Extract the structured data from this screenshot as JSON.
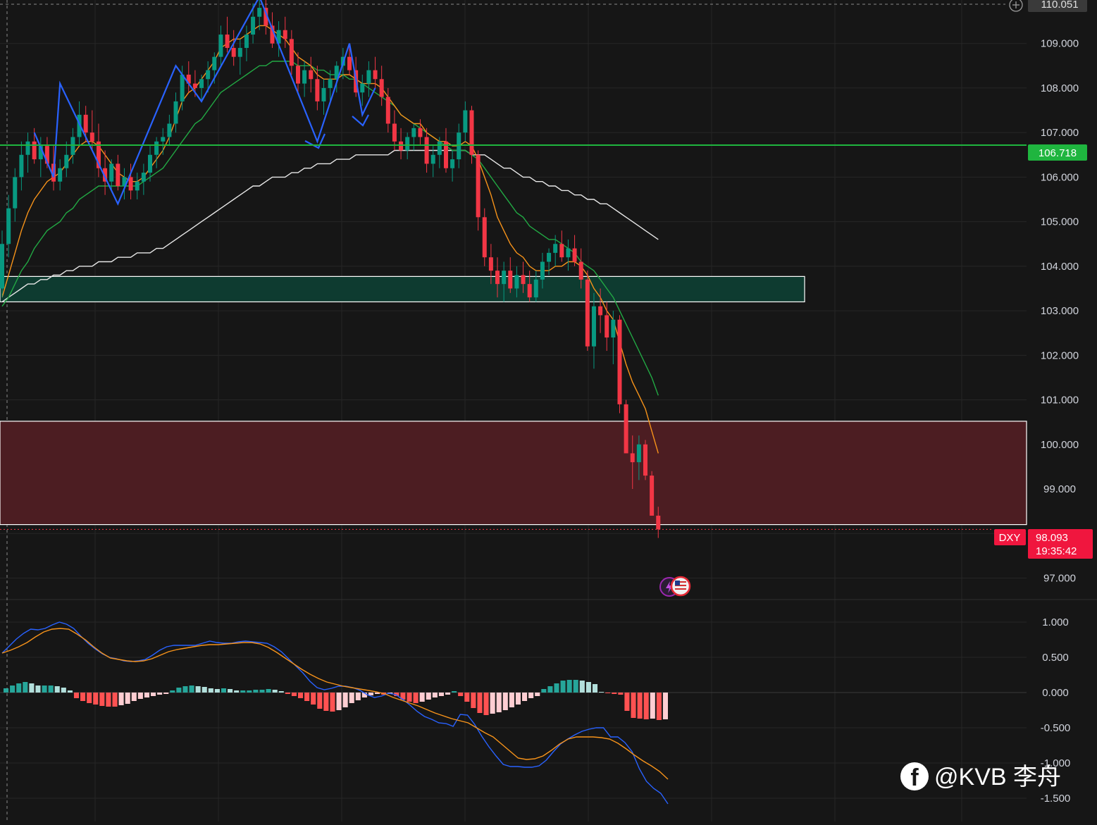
{
  "symbol": "DXY",
  "price_axis": {
    "ticks": [
      "110.051",
      "109.000",
      "108.000",
      "107.000",
      "106.000",
      "105.000",
      "104.000",
      "103.000",
      "102.000",
      "101.000",
      "100.000",
      "99.000",
      "97.000"
    ],
    "tick_values": [
      110.051,
      109,
      108,
      107,
      106,
      105,
      104,
      103,
      102,
      101,
      100,
      99,
      97
    ],
    "range": [
      96.5,
      110.1
    ]
  },
  "macd_axis": {
    "ticks": [
      "1.000",
      "0.500",
      "0.000",
      "-0.500",
      "-1.000",
      "-1.500"
    ],
    "tick_values": [
      1,
      0.5,
      0,
      -0.5,
      -1,
      -1.5
    ],
    "range": [
      -1.8,
      1.5
    ]
  },
  "labels": {
    "last_price": "98.093",
    "countdown": "19:35:42",
    "support_price": "106.718",
    "symbol_tag": "DXY",
    "watermark": "@KVB 李舟"
  },
  "colors": {
    "background": "#161616",
    "bull": "#089981",
    "bear": "#f23645",
    "ma_fast": "#f7931a",
    "ma_mid": "#22a944",
    "ma_slow": "#e8e8e8",
    "support_line": "#1fb53f",
    "zigzag": "#2962ff",
    "demand_zone": "#0e3b30",
    "supply_zone": "#4c1d22",
    "macd_line": "#2962ff",
    "signal_line": "#f7931a"
  },
  "chart_data": {
    "type": "candlestick",
    "symbol": "DXY",
    "last_price": 98.093,
    "horizontal_line": 106.718,
    "zones": [
      {
        "kind": "demand",
        "from": 103.2,
        "to": 103.77,
        "x_end": 140
      },
      {
        "kind": "supply",
        "from": 98.2,
        "to": 100.52
      }
    ],
    "ylim": [
      96.5,
      110.1
    ],
    "candles": [
      [
        103.5,
        104.8,
        103.3,
        104.5
      ],
      [
        104.5,
        105.6,
        104.2,
        105.3
      ],
      [
        105.3,
        106.2,
        105.0,
        106.0
      ],
      [
        106.0,
        106.8,
        105.7,
        106.5
      ],
      [
        106.5,
        107.0,
        106.1,
        106.8
      ],
      [
        106.8,
        107.1,
        106.3,
        106.4
      ],
      [
        106.4,
        106.9,
        106.0,
        106.7
      ],
      [
        106.7,
        106.9,
        106.2,
        106.3
      ],
      [
        106.3,
        106.7,
        105.7,
        105.9
      ],
      [
        105.9,
        106.4,
        105.7,
        106.2
      ],
      [
        106.2,
        106.8,
        106.0,
        106.5
      ],
      [
        106.5,
        107.1,
        106.3,
        106.9
      ],
      [
        106.9,
        107.7,
        106.7,
        107.4
      ],
      [
        107.4,
        107.6,
        106.8,
        107.0
      ],
      [
        107.0,
        107.5,
        106.6,
        106.8
      ],
      [
        106.8,
        107.2,
        106.0,
        106.2
      ],
      [
        106.2,
        106.6,
        105.6,
        105.9
      ],
      [
        105.9,
        106.4,
        105.7,
        106.3
      ],
      [
        106.3,
        106.5,
        105.7,
        105.8
      ],
      [
        105.8,
        106.2,
        105.5,
        106.0
      ],
      [
        106.0,
        106.3,
        105.5,
        105.7
      ],
      [
        105.7,
        106.1,
        105.5,
        105.9
      ],
      [
        105.9,
        106.3,
        105.6,
        106.1
      ],
      [
        106.1,
        106.7,
        105.9,
        106.5
      ],
      [
        106.5,
        106.9,
        106.2,
        106.8
      ],
      [
        106.8,
        107.1,
        106.5,
        106.9
      ],
      [
        106.9,
        107.4,
        106.7,
        107.2
      ],
      [
        107.2,
        107.9,
        107.0,
        107.7
      ],
      [
        107.7,
        108.5,
        107.5,
        108.3
      ],
      [
        108.3,
        108.6,
        107.9,
        108.1
      ],
      [
        108.1,
        108.4,
        107.8,
        108.0
      ],
      [
        108.0,
        108.3,
        107.7,
        108.2
      ],
      [
        108.2,
        108.6,
        107.9,
        108.4
      ],
      [
        108.4,
        108.8,
        108.1,
        108.7
      ],
      [
        108.7,
        109.4,
        108.5,
        109.2
      ],
      [
        109.2,
        109.6,
        108.8,
        108.9
      ],
      [
        108.9,
        109.3,
        108.5,
        108.7
      ],
      [
        108.7,
        109.1,
        108.3,
        108.9
      ],
      [
        108.9,
        109.4,
        108.6,
        109.2
      ],
      [
        109.2,
        109.9,
        109.0,
        109.6
      ],
      [
        109.6,
        110.05,
        109.3,
        109.8
      ],
      [
        109.8,
        110.0,
        109.2,
        109.4
      ],
      [
        109.4,
        109.7,
        108.9,
        109.0
      ],
      [
        109.0,
        109.5,
        108.7,
        109.3
      ],
      [
        109.3,
        109.6,
        108.9,
        109.1
      ],
      [
        109.1,
        109.3,
        108.3,
        108.5
      ],
      [
        108.5,
        108.8,
        107.9,
        108.1
      ],
      [
        108.1,
        108.6,
        107.8,
        108.4
      ],
      [
        108.4,
        108.7,
        107.9,
        108.2
      ],
      [
        108.2,
        108.5,
        107.5,
        107.7
      ],
      [
        107.7,
        108.2,
        107.4,
        108.0
      ],
      [
        108.0,
        108.4,
        107.7,
        108.2
      ],
      [
        108.2,
        108.6,
        107.9,
        108.5
      ],
      [
        108.5,
        108.9,
        108.2,
        108.7
      ],
      [
        108.7,
        109.0,
        108.3,
        108.4
      ],
      [
        108.4,
        108.7,
        107.8,
        107.9
      ],
      [
        107.9,
        108.3,
        107.6,
        108.1
      ],
      [
        108.1,
        108.6,
        107.8,
        108.4
      ],
      [
        108.4,
        108.7,
        108.0,
        108.2
      ],
      [
        108.2,
        108.5,
        107.6,
        107.8
      ],
      [
        107.8,
        108.0,
        107.0,
        107.2
      ],
      [
        107.2,
        107.5,
        106.6,
        106.8
      ],
      [
        106.8,
        107.1,
        106.4,
        106.6
      ],
      [
        106.6,
        107.0,
        106.4,
        106.9
      ],
      [
        106.9,
        107.2,
        106.6,
        107.1
      ],
      [
        107.1,
        107.3,
        106.7,
        106.9
      ],
      [
        106.9,
        107.1,
        106.1,
        106.3
      ],
      [
        106.3,
        106.7,
        106.0,
        106.5
      ],
      [
        106.5,
        106.9,
        106.2,
        106.8
      ],
      [
        106.8,
        107.1,
        106.1,
        106.2
      ],
      [
        106.2,
        106.6,
        105.9,
        106.4
      ],
      [
        106.4,
        107.2,
        106.2,
        107.0
      ],
      [
        107.0,
        107.7,
        106.8,
        107.5
      ],
      [
        107.5,
        107.6,
        106.3,
        106.5
      ],
      [
        106.5,
        106.6,
        104.8,
        105.1
      ],
      [
        105.1,
        105.3,
        104.0,
        104.2
      ],
      [
        104.2,
        104.5,
        103.6,
        103.9
      ],
      [
        103.9,
        104.2,
        103.3,
        103.6
      ],
      [
        103.6,
        104.1,
        103.2,
        103.9
      ],
      [
        103.9,
        104.2,
        103.4,
        103.5
      ],
      [
        103.5,
        104.0,
        103.3,
        103.8
      ],
      [
        103.8,
        104.1,
        103.4,
        103.6
      ],
      [
        103.6,
        103.9,
        103.2,
        103.3
      ],
      [
        103.3,
        103.9,
        103.2,
        103.7
      ],
      [
        103.7,
        104.3,
        103.5,
        104.1
      ],
      [
        104.1,
        104.4,
        103.8,
        104.3
      ],
      [
        104.3,
        104.7,
        104.0,
        104.5
      ],
      [
        104.5,
        104.8,
        104.1,
        104.2
      ],
      [
        104.2,
        104.6,
        103.9,
        104.4
      ],
      [
        104.4,
        104.7,
        104.0,
        104.1
      ],
      [
        104.1,
        104.4,
        103.5,
        103.7
      ],
      [
        103.7,
        103.9,
        102.1,
        102.2
      ],
      [
        102.2,
        103.4,
        101.7,
        103.1
      ],
      [
        103.1,
        103.5,
        102.5,
        102.9
      ],
      [
        102.9,
        103.2,
        102.1,
        102.4
      ],
      [
        102.4,
        103.0,
        101.8,
        102.8
      ],
      [
        102.8,
        102.9,
        100.7,
        100.9
      ],
      [
        100.9,
        101.0,
        99.9,
        99.8
      ],
      [
        99.8,
        100.2,
        99.0,
        99.6
      ],
      [
        99.6,
        100.2,
        99.2,
        100.0
      ],
      [
        100.0,
        100.1,
        99.2,
        99.3
      ],
      [
        99.3,
        99.4,
        98.4,
        98.4
      ],
      [
        98.4,
        98.6,
        97.9,
        98.093
      ]
    ],
    "ma_fast": [
      103.3,
      103.8,
      104.3,
      104.8,
      105.2,
      105.5,
      105.7,
      105.9,
      106.0,
      106.1,
      106.3,
      106.5,
      106.7,
      106.8,
      106.8,
      106.7,
      106.5,
      106.3,
      106.1,
      106.0,
      105.9,
      105.9,
      106.0,
      106.2,
      106.4,
      106.6,
      106.9,
      107.3,
      107.7,
      107.9,
      108.0,
      108.2,
      108.4,
      108.6,
      108.9,
      109.0,
      109.1,
      109.1,
      109.2,
      109.3,
      109.4,
      109.4,
      109.3,
      109.2,
      109.1,
      108.9,
      108.7,
      108.6,
      108.5,
      108.3,
      108.2,
      108.2,
      108.2,
      108.3,
      108.3,
      108.2,
      108.1,
      108.1,
      108.1,
      108.0,
      107.8,
      107.6,
      107.4,
      107.3,
      107.2,
      107.2,
      107.0,
      106.9,
      106.8,
      106.8,
      106.7,
      106.7,
      106.8,
      106.7,
      106.4,
      106.0,
      105.6,
      105.1,
      104.8,
      104.5,
      104.3,
      104.2,
      104.0,
      103.9,
      103.9,
      103.9,
      104.0,
      104.0,
      104.1,
      104.1,
      104.0,
      103.8,
      103.5,
      103.3,
      103.0,
      102.8,
      102.3,
      101.8,
      101.4,
      101.1,
      100.8,
      100.3,
      99.8
    ],
    "ma_mid": [
      103.1,
      103.3,
      103.6,
      103.9,
      104.1,
      104.4,
      104.6,
      104.8,
      104.9,
      105.0,
      105.2,
      105.3,
      105.5,
      105.6,
      105.7,
      105.8,
      105.8,
      105.8,
      105.8,
      105.8,
      105.8,
      105.8,
      105.9,
      106.0,
      106.1,
      106.2,
      106.4,
      106.6,
      106.8,
      107.0,
      107.2,
      107.3,
      107.5,
      107.7,
      107.9,
      108.0,
      108.1,
      108.2,
      108.3,
      108.4,
      108.5,
      108.5,
      108.6,
      108.6,
      108.6,
      108.6,
      108.5,
      108.5,
      108.5,
      108.4,
      108.4,
      108.3,
      108.3,
      108.3,
      108.2,
      108.2,
      108.1,
      108.0,
      107.9,
      107.8,
      107.7,
      107.6,
      107.4,
      107.3,
      107.2,
      107.1,
      107.0,
      106.9,
      106.8,
      106.7,
      106.6,
      106.6,
      106.6,
      106.5,
      106.4,
      106.2,
      106.0,
      105.8,
      105.6,
      105.4,
      105.2,
      105.1,
      104.9,
      104.8,
      104.7,
      104.6,
      104.6,
      104.5,
      104.4,
      104.3,
      104.1,
      104.0,
      103.9,
      103.7,
      103.5,
      103.3,
      103.0,
      102.7,
      102.4,
      102.1,
      101.8,
      101.5,
      101.1
    ],
    "ma_slow": [
      103.2,
      103.3,
      103.4,
      103.5,
      103.6,
      103.6,
      103.7,
      103.7,
      103.8,
      103.8,
      103.9,
      103.9,
      104.0,
      104.0,
      104.0,
      104.1,
      104.1,
      104.1,
      104.2,
      104.2,
      104.2,
      104.3,
      104.3,
      104.3,
      104.4,
      104.4,
      104.5,
      104.6,
      104.7,
      104.8,
      104.9,
      105.0,
      105.1,
      105.2,
      105.3,
      105.4,
      105.5,
      105.6,
      105.7,
      105.8,
      105.8,
      105.9,
      106.0,
      106.0,
      106.0,
      106.1,
      106.1,
      106.2,
      106.2,
      106.3,
      106.3,
      106.3,
      106.4,
      106.4,
      106.4,
      106.5,
      106.5,
      106.5,
      106.5,
      106.5,
      106.5,
      106.6,
      106.6,
      106.6,
      106.6,
      106.6,
      106.6,
      106.6,
      106.6,
      106.6,
      106.6,
      106.6,
      106.6,
      106.5,
      106.5,
      106.5,
      106.4,
      106.3,
      106.2,
      106.2,
      106.1,
      106.0,
      106.0,
      105.9,
      105.9,
      105.8,
      105.8,
      105.7,
      105.7,
      105.6,
      105.6,
      105.5,
      105.5,
      105.4,
      105.4,
      105.3,
      105.2,
      105.1,
      105.0,
      104.9,
      104.8,
      104.7,
      104.6
    ],
    "macd": {
      "macd_line": [
        0.56,
        0.66,
        0.76,
        0.84,
        0.9,
        0.89,
        0.91,
        0.96,
        1.0,
        0.97,
        0.91,
        0.8,
        0.7,
        0.62,
        0.55,
        0.5,
        0.48,
        0.45,
        0.44,
        0.45,
        0.47,
        0.53,
        0.6,
        0.65,
        0.67,
        0.67,
        0.67,
        0.67,
        0.7,
        0.73,
        0.71,
        0.7,
        0.7,
        0.72,
        0.73,
        0.72,
        0.71,
        0.7,
        0.65,
        0.58,
        0.48,
        0.38,
        0.28,
        0.16,
        0.07,
        0.04,
        0.06,
        0.09,
        0.09,
        0.07,
        0.03,
        -0.03,
        -0.07,
        -0.05,
        -0.01,
        -0.03,
        -0.1,
        -0.18,
        -0.27,
        -0.34,
        -0.38,
        -0.43,
        -0.44,
        -0.48,
        -0.31,
        -0.32,
        -0.45,
        -0.62,
        -0.77,
        -0.9,
        -1.02,
        -1.05,
        -1.05,
        -1.06,
        -1.06,
        -1.04,
        -0.96,
        -0.84,
        -0.73,
        -0.66,
        -0.6,
        -0.55,
        -0.52,
        -0.5,
        -0.5,
        -0.63,
        -0.63,
        -0.71,
        -0.84,
        -1.08,
        -1.26,
        -1.36,
        -1.43,
        -1.58
      ],
      "signal_line": [
        0.56,
        0.6,
        0.65,
        0.71,
        0.79,
        0.86,
        0.9,
        0.91,
        0.9,
        0.83,
        0.75,
        0.65,
        0.56,
        0.49,
        0.47,
        0.45,
        0.44,
        0.45,
        0.48,
        0.53,
        0.58,
        0.61,
        0.63,
        0.65,
        0.67,
        0.68,
        0.68,
        0.69,
        0.7,
        0.71,
        0.71,
        0.69,
        0.64,
        0.57,
        0.49,
        0.41,
        0.33,
        0.26,
        0.2,
        0.15,
        0.12,
        0.09,
        0.07,
        0.05,
        0.03,
        0.01,
        -0.02,
        -0.07,
        -0.11,
        -0.15,
        -0.19,
        -0.24,
        -0.29,
        -0.33,
        -0.37,
        -0.4,
        -0.43,
        -0.5,
        -0.57,
        -0.63,
        -0.73,
        -0.83,
        -0.93,
        -0.95,
        -0.94,
        -0.9,
        -0.82,
        -0.73,
        -0.66,
        -0.63,
        -0.63,
        -0.63,
        -0.64,
        -0.66,
        -0.72,
        -0.8,
        -0.89,
        -0.97,
        -1.04,
        -1.12,
        -1.23
      ],
      "histogram": [
        0.06,
        0.1,
        0.13,
        0.15,
        0.13,
        0.1,
        0.1,
        0.1,
        0.09,
        0.07,
        0.03,
        -0.08,
        -0.12,
        -0.15,
        -0.17,
        -0.19,
        -0.2,
        -0.2,
        -0.18,
        -0.16,
        -0.12,
        -0.09,
        -0.07,
        -0.05,
        -0.03,
        -0.02,
        0.03,
        0.07,
        0.09,
        0.1,
        0.09,
        0.08,
        0.06,
        0.05,
        0.06,
        0.05,
        0.03,
        0.03,
        0.03,
        0.04,
        0.04,
        0.05,
        0.04,
        0.02,
        -0.02,
        -0.05,
        -0.08,
        -0.12,
        -0.17,
        -0.23,
        -0.26,
        -0.27,
        -0.25,
        -0.21,
        -0.15,
        -0.11,
        -0.07,
        -0.04,
        -0.02,
        -0.03,
        -0.02,
        -0.05,
        -0.1,
        -0.13,
        -0.15,
        -0.13,
        -0.1,
        -0.07,
        -0.05,
        -0.03,
        0.02,
        -0.05,
        -0.13,
        -0.22,
        -0.29,
        -0.32,
        -0.3,
        -0.28,
        -0.25,
        -0.21,
        -0.17,
        -0.12,
        -0.08,
        -0.05,
        0.05,
        0.09,
        0.13,
        0.17,
        0.18,
        0.18,
        0.17,
        0.15,
        0.12,
        0.01,
        -0.01,
        -0.02,
        -0.03,
        -0.26,
        -0.36,
        -0.37,
        -0.38,
        -0.37,
        -0.39,
        -0.38
      ]
    }
  }
}
